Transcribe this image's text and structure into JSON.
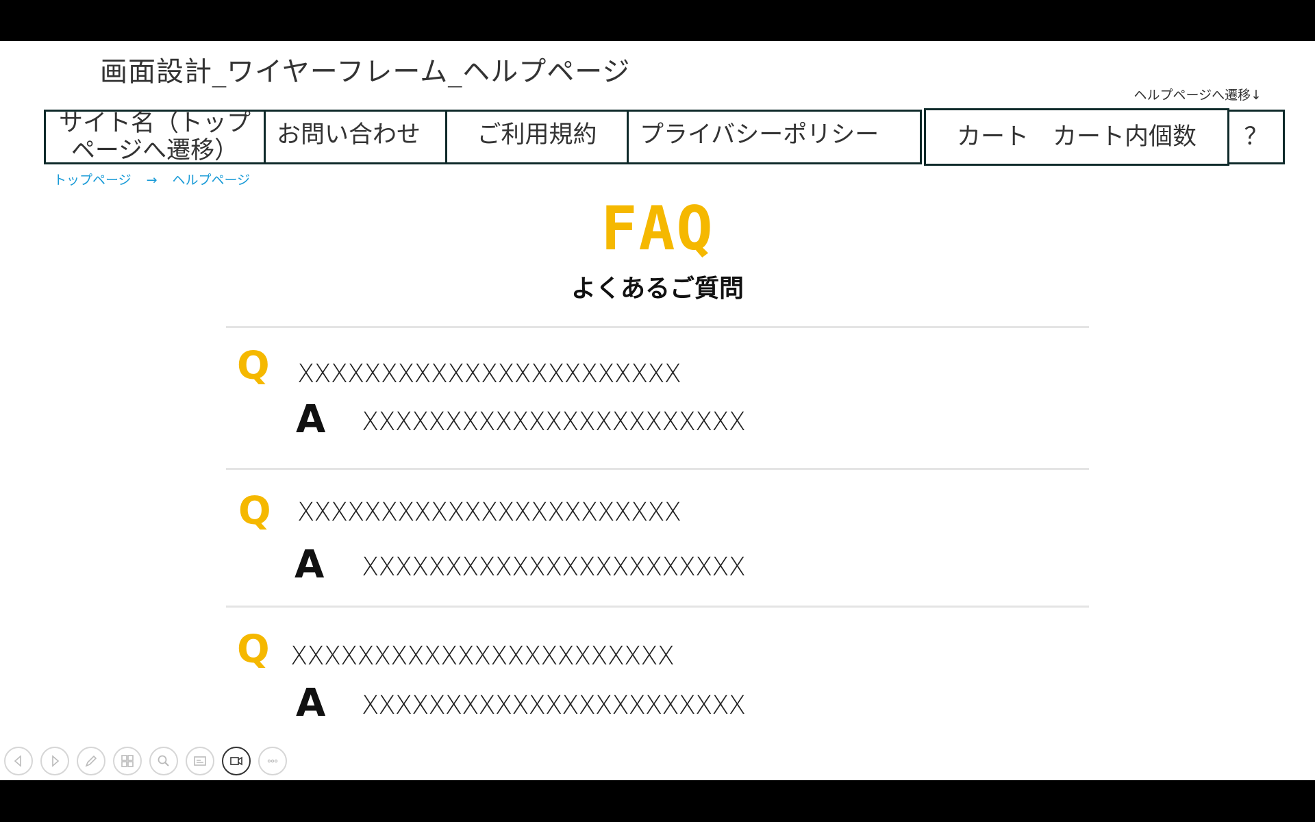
{
  "slide_title": "画面設計_ワイヤーフレーム_ヘルプページ",
  "nav_note": "ヘルプページへ遷移↓",
  "nav": {
    "site_name_line1": "サイト名（トップ",
    "site_name_line2": "ページへ遷移）",
    "contact": "お問い合わせ",
    "terms": "ご利用規約",
    "privacy": "プライバシーポリシー",
    "cart": "カート　カート内個数",
    "help": "？"
  },
  "breadcrumb": {
    "top": "トップページ",
    "arrow": "→",
    "current": "ヘルプページ"
  },
  "faq": {
    "heading": "FAQ",
    "subheading": "よくあるご質問",
    "q_label": "Q",
    "a_label": "A",
    "items": [
      {
        "question": "XXXXXXXXXXXXXXXXXXXXXXX",
        "answer": "XXXXXXXXXXXXXXXXXXXXXXX"
      },
      {
        "question": "XXXXXXXXXXXXXXXXXXXXXXX",
        "answer": "XXXXXXXXXXXXXXXXXXXXXXX"
      },
      {
        "question": "XXXXXXXXXXXXXXXXXXXXXXX",
        "answer": "XXXXXXXXXXXXXXXXXXXXXXX"
      }
    ]
  },
  "toolbar": {
    "buttons": [
      "back-icon",
      "forward-icon",
      "pen-icon",
      "slides-icon",
      "zoom-icon",
      "subtitles-icon",
      "camera-icon",
      "more-icon"
    ]
  },
  "colors": {
    "accent": "#f5b800",
    "link": "#1a9bd7",
    "border": "#0f2a2a"
  }
}
